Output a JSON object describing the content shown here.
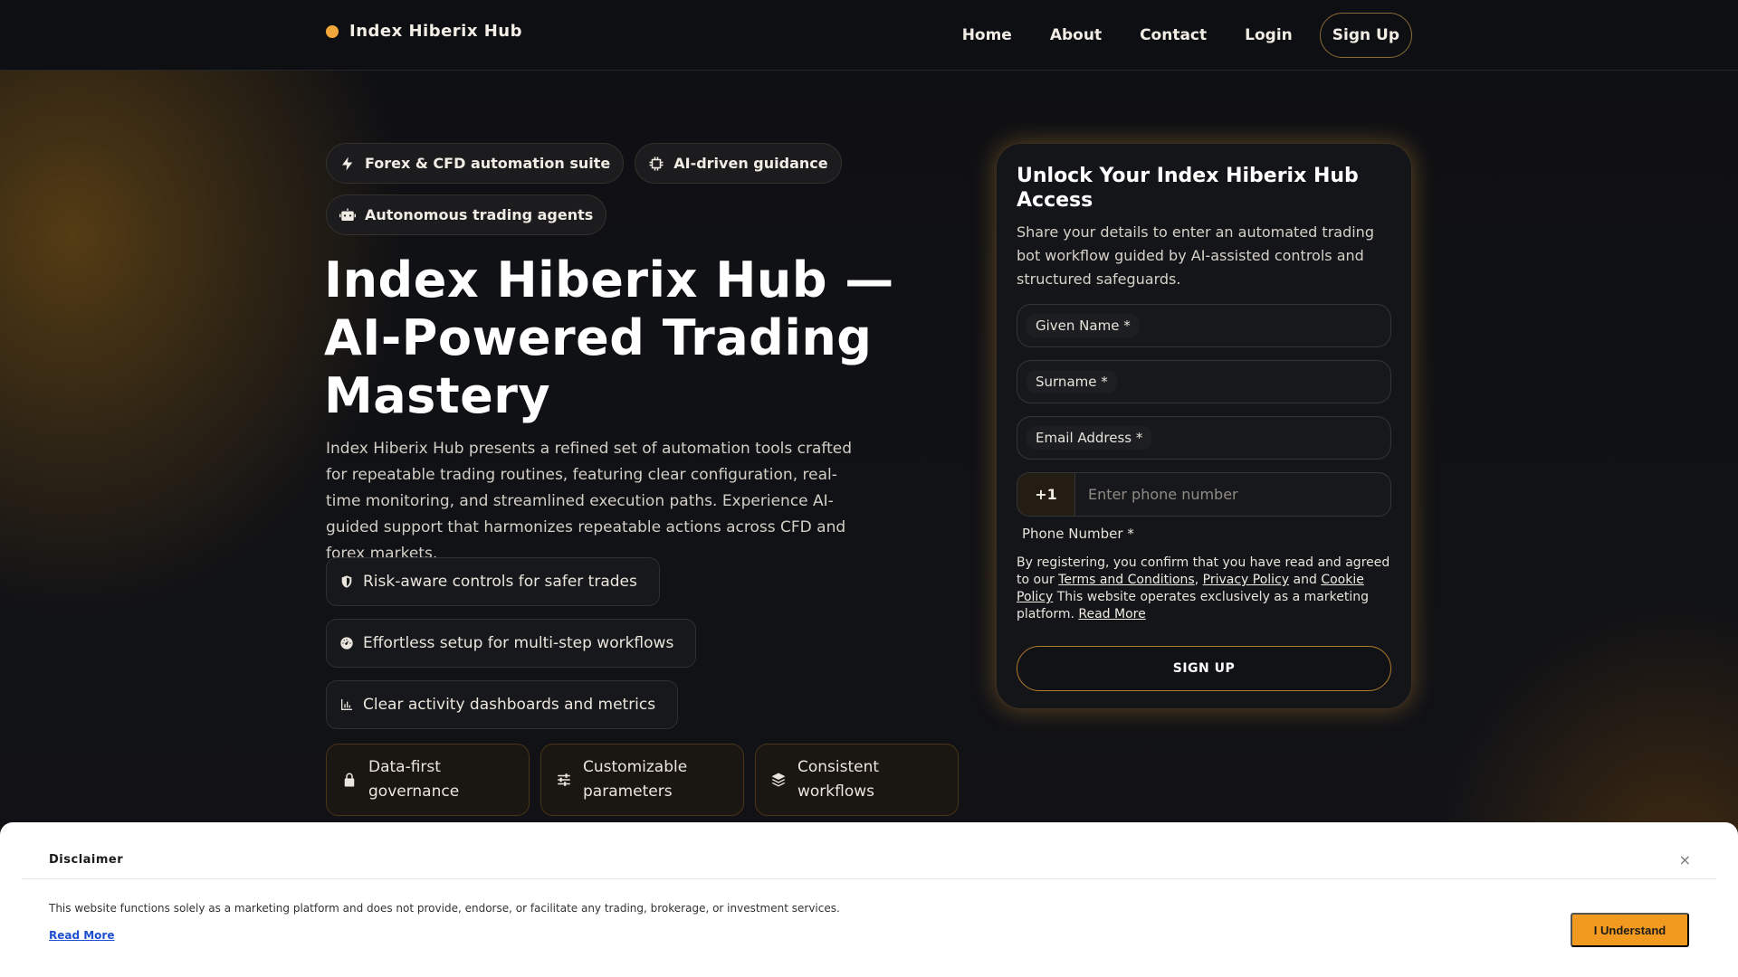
{
  "nav": {
    "brand": "Index Hiberix Hub",
    "links": [
      "Home",
      "About",
      "Contact",
      "Login"
    ],
    "signup": "Sign Up"
  },
  "hero": {
    "chips": [
      {
        "label": "Forex & CFD automation suite",
        "icon": "bolt-icon"
      },
      {
        "label": "AI-driven guidance",
        "icon": "chip-icon"
      },
      {
        "label": "Autonomous trading agents",
        "icon": "robot-icon"
      }
    ],
    "title": "Index Hiberix Hub — AI-Powered Trading Mastery",
    "description": "Index Hiberix Hub presents a refined set of automation tools crafted for repeatable trading routines, featuring clear configuration, real-time monitoring, and streamlined execution paths. Experience AI-guided support that harmonizes repeatable actions across CFD and forex markets.",
    "features": [
      {
        "label": "Risk-aware controls for safer trades",
        "icon": "shield-icon"
      },
      {
        "label": "Effortless setup for multi-step workflows",
        "icon": "gauge-icon"
      },
      {
        "label": "Clear activity dashboards and metrics",
        "icon": "chart-icon"
      }
    ],
    "cards": [
      {
        "label": "Data-first governance",
        "icon": "lock-icon"
      },
      {
        "label": "Customizable parameters",
        "icon": "sliders-icon"
      },
      {
        "label": "Consistent workflows",
        "icon": "layers-icon"
      }
    ]
  },
  "form": {
    "title": "Unlock Your Index Hiberix Hub Access",
    "subtitle": "Share your details to enter an automated trading bot workflow guided by AI-assisted controls and structured safeguards.",
    "given_name": "Given Name *",
    "surname": "Surname *",
    "email": "Email Address *",
    "phone_code": "+1",
    "phone_placeholder": "Enter phone number",
    "phone_label": "Phone Number *",
    "legal_prefix": "By registering, you confirm that you have read and agreed to our",
    "terms": "Terms and Conditions",
    "comma": ",",
    "privacy": "Privacy Policy",
    "and": "and",
    "cookie": "Cookie Policy",
    "legal_suffix": "This website operates exclusively as a marketing platform.",
    "read_more": "Read More",
    "submit": "SIGN UP"
  },
  "disclaimer": {
    "title": "Disclaimer",
    "close": "×",
    "text": "This website functions solely as a marketing platform and does not provide, endorse, or facilitate any trading, brokerage, or investment services.",
    "read_more": "Read More",
    "button": "I Understand"
  },
  "colors": {
    "accent": "#f2a73b",
    "button_orange": "#f29a1f",
    "background": "#0f1013"
  }
}
